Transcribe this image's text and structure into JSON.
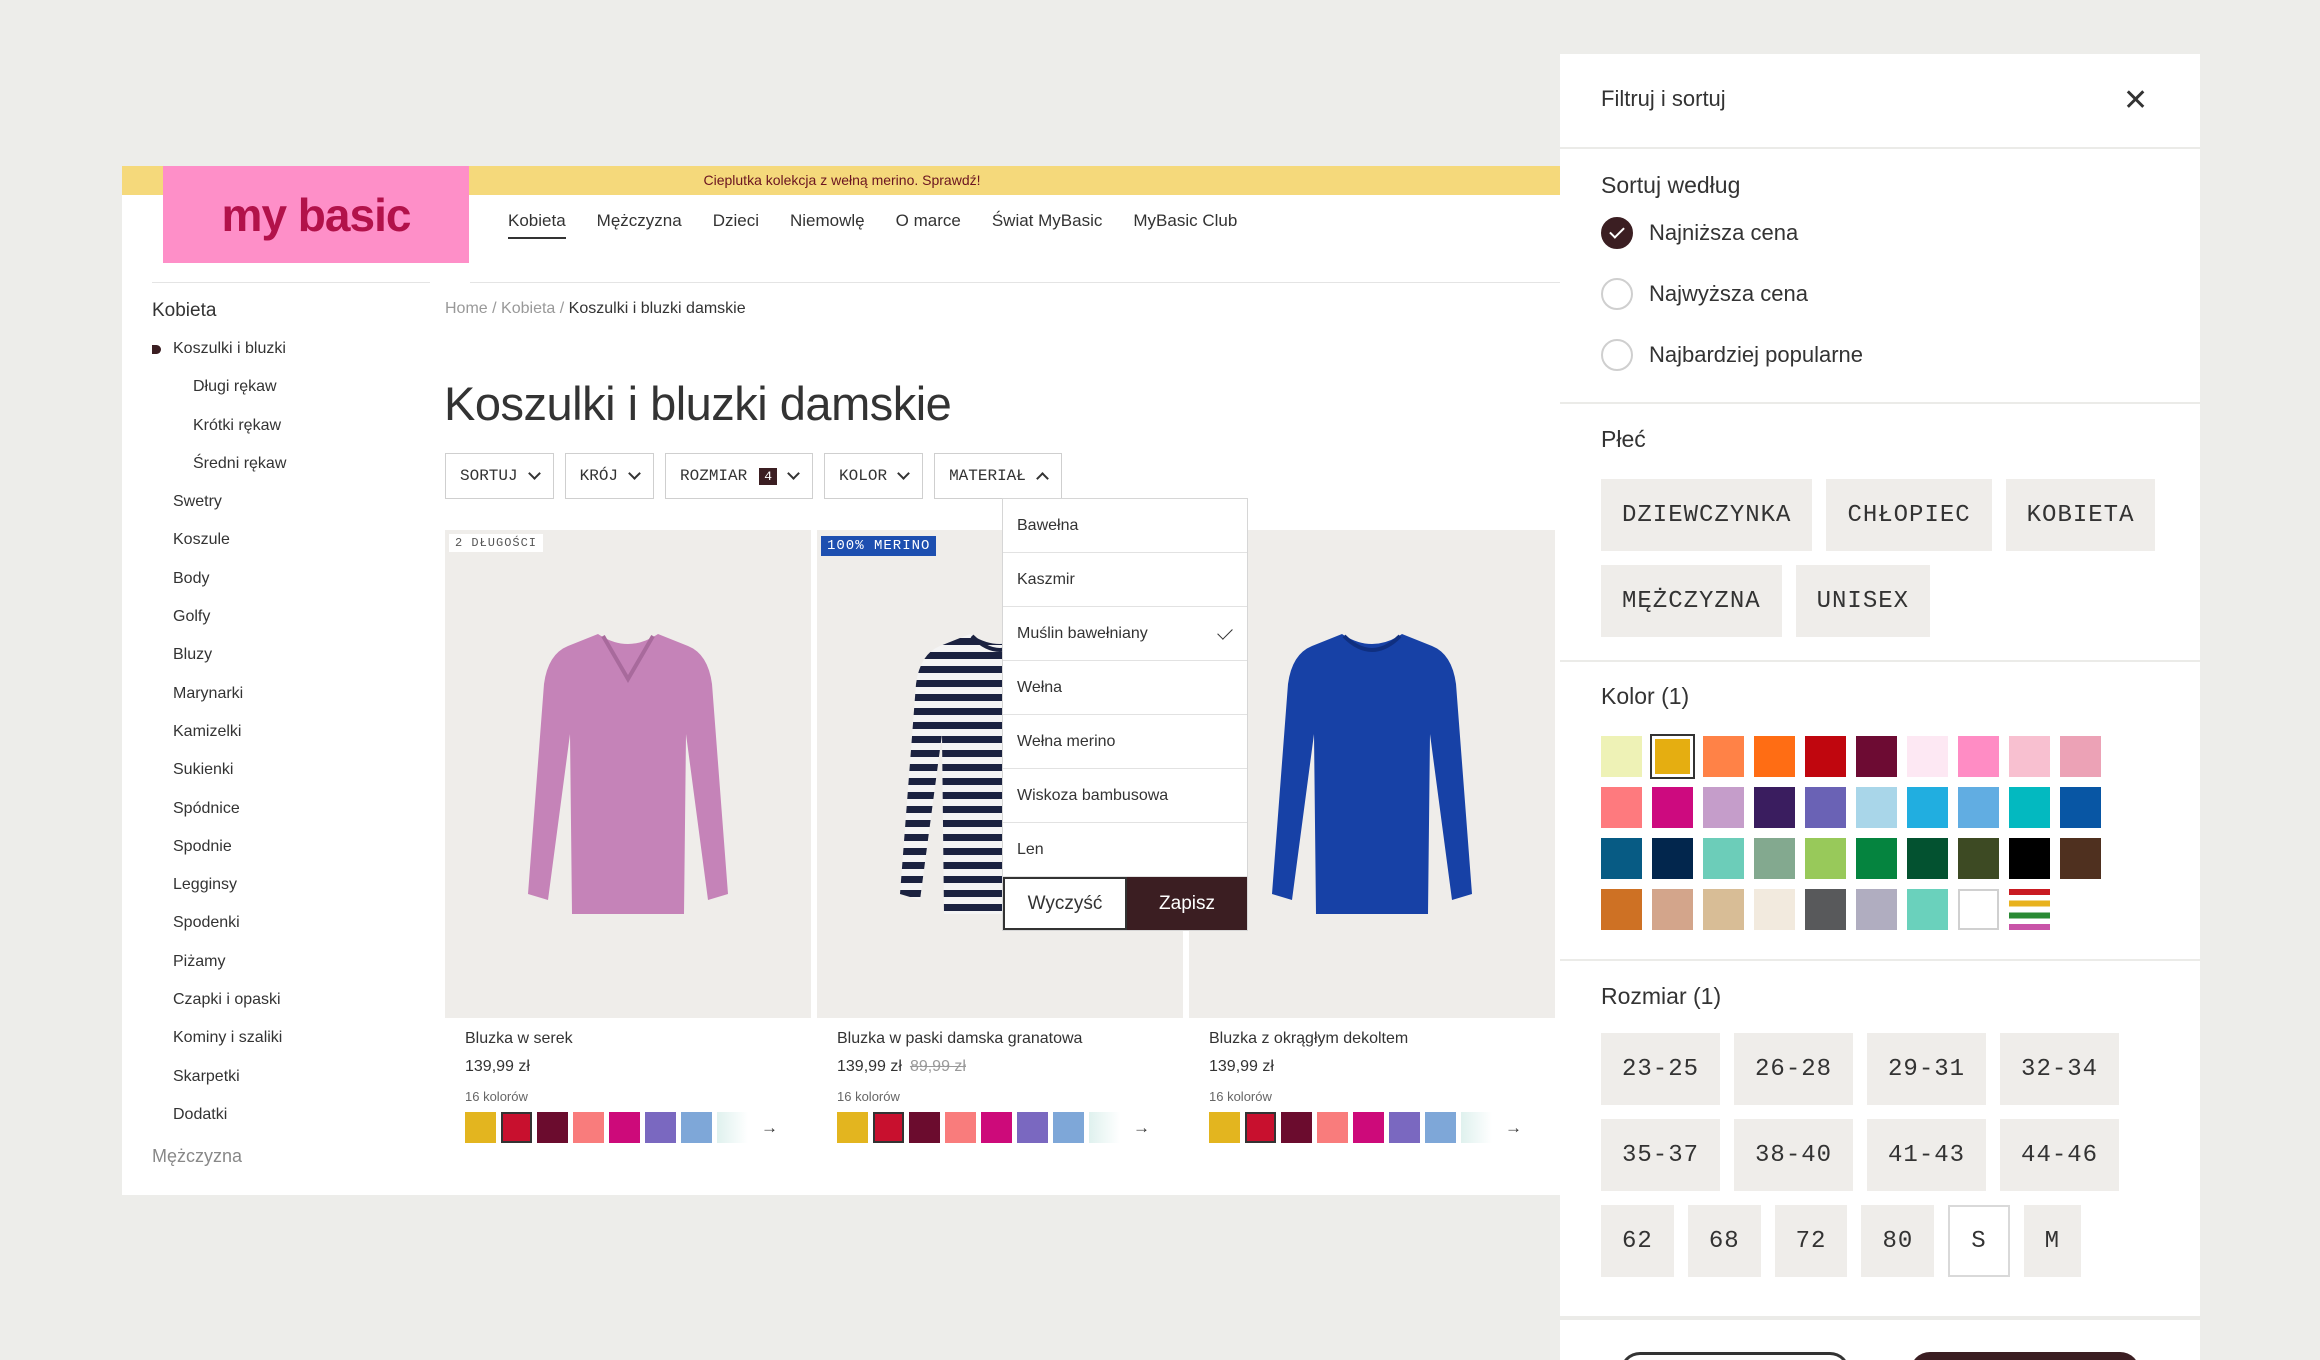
{
  "promo": "Cieplutka kolekcja z wełną merino. Sprawdź!",
  "logo": "my basic",
  "nav": [
    "Kobieta",
    "Mężczyzna",
    "Dzieci",
    "Niemowlę",
    "O marce",
    "Świat MyBasic",
    "MyBasic Club"
  ],
  "sidebar": {
    "heading": "Kobieta",
    "items": [
      {
        "label": "Koszulki i bluzki",
        "level": 1,
        "active": true
      },
      {
        "label": "Długi rękaw",
        "level": 2
      },
      {
        "label": "Krótki rękaw",
        "level": 2
      },
      {
        "label": "Średni rękaw",
        "level": 2
      },
      {
        "label": "Swetry",
        "level": 1
      },
      {
        "label": "Koszule",
        "level": 1
      },
      {
        "label": "Body",
        "level": 1
      },
      {
        "label": "Golfy",
        "level": 1
      },
      {
        "label": "Bluzy",
        "level": 1
      },
      {
        "label": "Marynarki",
        "level": 1
      },
      {
        "label": "Kamizelki",
        "level": 1
      },
      {
        "label": "Sukienki",
        "level": 1
      },
      {
        "label": "Spódnice",
        "level": 1
      },
      {
        "label": "Spodnie",
        "level": 1
      },
      {
        "label": "Legginsy",
        "level": 1
      },
      {
        "label": "Spodenki",
        "level": 1
      },
      {
        "label": "Piżamy",
        "level": 1
      },
      {
        "label": "Czapki i opaski",
        "level": 1
      },
      {
        "label": "Kominy i szaliki",
        "level": 1
      },
      {
        "label": "Skarpetki",
        "level": 1
      },
      {
        "label": "Dodatki",
        "level": 1
      }
    ],
    "footer": "Mężczyzna"
  },
  "breadcrumb": {
    "home": "Home",
    "sep": "/",
    "cat": "Kobieta",
    "current": "Koszulki i bluzki damskie"
  },
  "title": "Koszulki i bluzki damskie",
  "filters": [
    {
      "label": "SORTUJ",
      "badge": "",
      "open": false
    },
    {
      "label": "KRÓJ",
      "badge": "",
      "open": false
    },
    {
      "label": "ROZMIAR",
      "badge": "4",
      "open": false
    },
    {
      "label": "KOLOR",
      "badge": "",
      "open": false
    },
    {
      "label": "MATERIAŁ",
      "badge": "",
      "open": true
    }
  ],
  "material_dropdown": {
    "options": [
      {
        "label": "Bawełna",
        "checked": false
      },
      {
        "label": "Kaszmir",
        "checked": false
      },
      {
        "label": "Muślin bawełniany",
        "checked": true
      },
      {
        "label": "Wełna",
        "checked": false
      },
      {
        "label": "Wełna merino",
        "checked": false
      },
      {
        "label": "Wiskoza bambusowa",
        "checked": false
      },
      {
        "label": "Len",
        "checked": false
      }
    ],
    "clear": "Wyczyść",
    "save": "Zapisz"
  },
  "products": [
    {
      "tag": "2 DŁUGOŚCI",
      "tag_style": "plain",
      "name": "Bluzka w serek",
      "price": "139,99 zł",
      "old_price": "",
      "colors_label": "16 kolorów",
      "shirt": "pink"
    },
    {
      "tag": "100% MERINO",
      "tag_style": "blue",
      "name": "Bluzka w paski damska granatowa",
      "price": "139,99 zł",
      "old_price": "89,99 zł",
      "colors_label": "16 kolorów",
      "shirt": "stripes"
    },
    {
      "tag": "",
      "tag_style": "none",
      "name": "Bluzka z okrągłym dekoltem",
      "price": "139,99 zł",
      "old_price": "",
      "colors_label": "16 kolorów",
      "shirt": "blue"
    }
  ],
  "card_swatches": [
    "#e3b51f",
    "#c8102e",
    "#6b0c2e",
    "#f97c7c",
    "#cd0a7a",
    "#7a68c0",
    "#7ea7d8",
    "#dff1ee"
  ],
  "panel": {
    "title": "Filtruj i sortuj",
    "sort": {
      "heading": "Sortuj według",
      "options": [
        {
          "label": "Najniższa cena",
          "on": true
        },
        {
          "label": "Najwyższa cena",
          "on": false
        },
        {
          "label": "Najbardziej popularne",
          "on": false
        }
      ]
    },
    "gender": {
      "heading": "Płeć",
      "options": [
        "DZIEWCZYNKA",
        "CHŁOPIEC",
        "KOBIETA",
        "MĘŻCZYZNA",
        "UNISEX"
      ]
    },
    "color": {
      "heading": "Kolor (1)",
      "swatches": [
        "#eef2b6",
        "#e5ae11",
        "#ff8247",
        "#ff6d14",
        "#c0060e",
        "#6d0b33",
        "#fde8f3",
        "#ff8cc4",
        "#f8c0d0",
        "#eca2b6",
        "#fe7a7e",
        "#cd0a7f",
        "#c59dca",
        "#3a1d5f",
        "#6a62b5",
        "#a9d6e9",
        "#21aee0",
        "#61ade2",
        "#03b9c0",
        "#0856a4",
        "#075b84",
        "#02264d",
        "#6ccdb9",
        "#83a98f",
        "#98c95a",
        "#05843f",
        "#035230",
        "#3d4a23",
        "#000000",
        "#4f301f",
        "#ce7124",
        "#d3a58b",
        "#d8bd96",
        "#f2eade",
        "#58595b",
        "#b0adc0",
        "#6ad1bc",
        "#ffffff",
        "multi"
      ],
      "selected_index": 1
    },
    "size": {
      "heading": "Rozmiar (1)",
      "options": [
        "23-25",
        "26-28",
        "29-31",
        "32-34",
        "35-37",
        "38-40",
        "41-43",
        "44-46",
        "62",
        "68",
        "72",
        "80",
        "S",
        "M"
      ],
      "selected": "S"
    }
  }
}
